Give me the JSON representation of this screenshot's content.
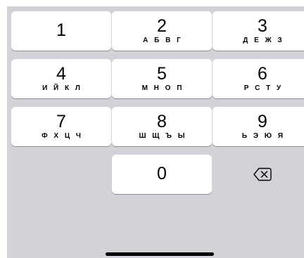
{
  "keypad": {
    "keys": [
      {
        "digit": "1",
        "letters": ""
      },
      {
        "digit": "2",
        "letters": "А Б В Г"
      },
      {
        "digit": "3",
        "letters": "Д Е Ж З"
      },
      {
        "digit": "4",
        "letters": "И Й К Л"
      },
      {
        "digit": "5",
        "letters": "М Н О П"
      },
      {
        "digit": "6",
        "letters": "Р С Т У"
      },
      {
        "digit": "7",
        "letters": "Ф Х Ц Ч"
      },
      {
        "digit": "8",
        "letters": "Ш Щ Ъ Ы"
      },
      {
        "digit": "9",
        "letters": "Ь Э Ю Я"
      },
      {
        "digit": "0",
        "letters": ""
      }
    ],
    "delete_icon": "backspace-icon",
    "colors": {
      "background": "#d1d3d9",
      "key": "#ffffff",
      "key_shadow": "#8a8d93",
      "text": "#000000"
    }
  }
}
